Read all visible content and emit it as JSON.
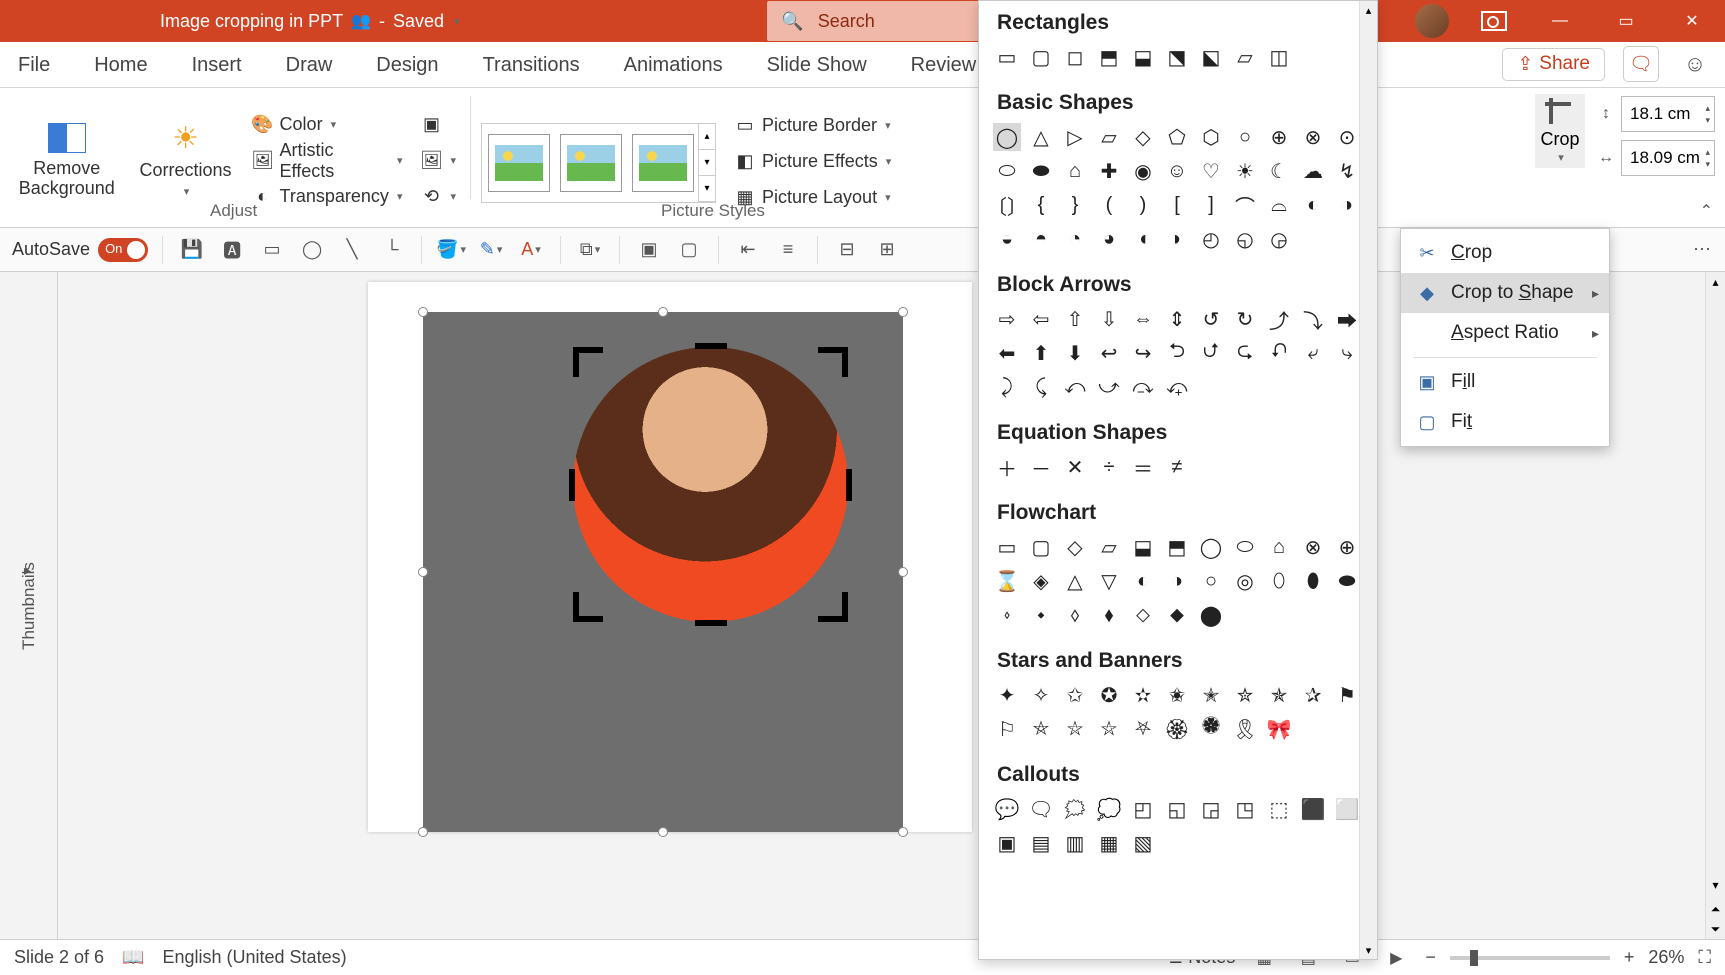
{
  "title": {
    "doc": "Image cropping in PPT",
    "state": "Saved"
  },
  "search": {
    "placeholder": "Search"
  },
  "win": {
    "share": "Share"
  },
  "tabs": [
    "File",
    "Home",
    "Insert",
    "Draw",
    "Design",
    "Transitions",
    "Animations",
    "Slide Show",
    "Review"
  ],
  "ribbon": {
    "removebg": "Remove\nBackground",
    "corrections": "Corrections",
    "color": "Color",
    "artistic": "Artistic Effects",
    "transparency": "Transparency",
    "adjust_label": "Adjust",
    "styles_label": "Picture Styles",
    "picborder": "Picture Border",
    "piceffects": "Picture Effects",
    "piclayout": "Picture Layout",
    "crop": "Crop",
    "height": "18.1 cm",
    "width": "18.09 cm"
  },
  "qat": {
    "autosave": "AutoSave",
    "on": "On"
  },
  "shape_categories": [
    {
      "name": "Rectangles",
      "count": 9,
      "selected": -1
    },
    {
      "name": "Basic Shapes",
      "count": 42,
      "selected": 0
    },
    {
      "name": "Block Arrows",
      "count": 28,
      "selected": -1
    },
    {
      "name": "Equation Shapes",
      "count": 6,
      "selected": -1
    },
    {
      "name": "Flowchart",
      "count": 29,
      "selected": -1
    },
    {
      "name": "Stars and Banners",
      "count": 20,
      "selected": -1
    },
    {
      "name": "Callouts",
      "count": 16,
      "selected": -1
    }
  ],
  "crop_menu": {
    "crop": "Crop",
    "to_shape": "Crop to Shape",
    "aspect": "Aspect Ratio",
    "fill": "Fill",
    "fit": "Fit"
  },
  "thumbnails_label": "Thumbnails",
  "status": {
    "slide": "Slide 2 of 6",
    "lang": "English (United States)",
    "notes": "Notes",
    "zoom": "26%"
  }
}
